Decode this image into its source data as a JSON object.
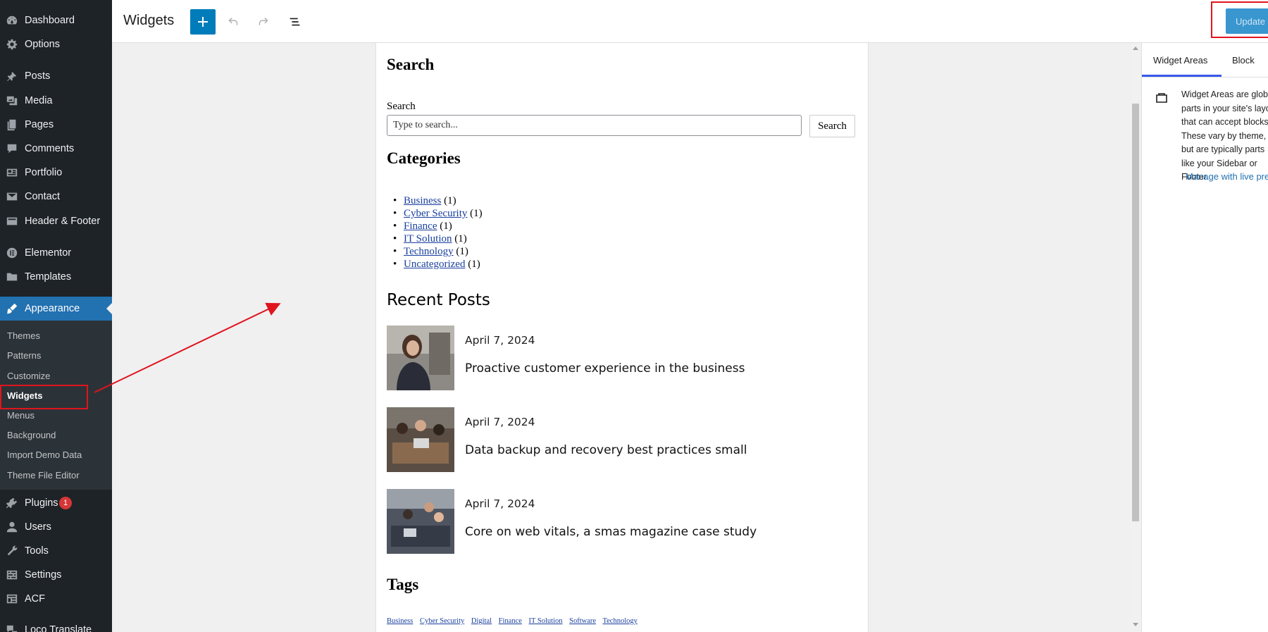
{
  "sidebar": {
    "items": [
      {
        "label": "Dashboard",
        "icon": "dashboard-icon"
      },
      {
        "label": "Options",
        "icon": "gear-icon"
      },
      {
        "label": "Posts",
        "icon": "pin-icon"
      },
      {
        "label": "Media",
        "icon": "media-icon"
      },
      {
        "label": "Pages",
        "icon": "pages-icon"
      },
      {
        "label": "Comments",
        "icon": "comment-icon"
      },
      {
        "label": "Portfolio",
        "icon": "portfolio-icon"
      },
      {
        "label": "Contact",
        "icon": "mail-icon"
      },
      {
        "label": "Header & Footer",
        "icon": "layout-icon"
      },
      {
        "label": "Elementor",
        "icon": "elementor-icon"
      },
      {
        "label": "Templates",
        "icon": "folder-icon"
      },
      {
        "label": "Appearance",
        "icon": "brush-icon"
      },
      {
        "label": "Plugins",
        "icon": "plug-icon",
        "badge": "1"
      },
      {
        "label": "Users",
        "icon": "user-icon"
      },
      {
        "label": "Tools",
        "icon": "wrench-icon"
      },
      {
        "label": "Settings",
        "icon": "settings-icon"
      },
      {
        "label": "ACF",
        "icon": "acf-icon"
      },
      {
        "label": "Loco Translate",
        "icon": "translate-icon"
      }
    ],
    "submenu": [
      "Themes",
      "Patterns",
      "Customize",
      "Widgets",
      "Menus",
      "Background",
      "Import Demo Data",
      "Theme File Editor"
    ]
  },
  "header": {
    "title": "Widgets",
    "update_label": "Update"
  },
  "canvas": {
    "search_heading": "Search",
    "search_label": "Search",
    "search_placeholder": "Type to search...",
    "search_button": "Search",
    "categories_heading": "Categories",
    "categories": [
      {
        "name": "Business",
        "count": "(1)"
      },
      {
        "name": "Cyber Security",
        "count": "(1)"
      },
      {
        "name": "Finance",
        "count": "(1)"
      },
      {
        "name": "IT Solution",
        "count": "(1)"
      },
      {
        "name": "Technology",
        "count": "(1)"
      },
      {
        "name": "Uncategorized",
        "count": "(1)"
      }
    ],
    "recent_heading": "Recent Posts",
    "posts": [
      {
        "date": "April 7, 2024",
        "title": "Proactive customer experience in the business"
      },
      {
        "date": "April 7, 2024",
        "title": "Data backup and recovery best practices small"
      },
      {
        "date": "April 7, 2024",
        "title": "Core on web vitals, a smas magazine case study"
      }
    ],
    "tags_heading": "Tags",
    "tags": [
      "Business",
      "Cyber Security",
      "Digital",
      "Finance",
      "IT Solution",
      "Software",
      "Technology"
    ]
  },
  "panel": {
    "tab_areas": "Widget Areas",
    "tab_block": "Block",
    "description": "Widget Areas are global parts in your site's layout that can accept blocks. These vary by theme, but are typically parts like your Sidebar or Footer.",
    "manage_link": "Manage with live preview"
  },
  "colors": {
    "sidebar_bg": "#1d2327",
    "accent": "#2271b1",
    "primary_button": "#007cba",
    "highlight": "#e0141e",
    "badge": "#d63638"
  }
}
